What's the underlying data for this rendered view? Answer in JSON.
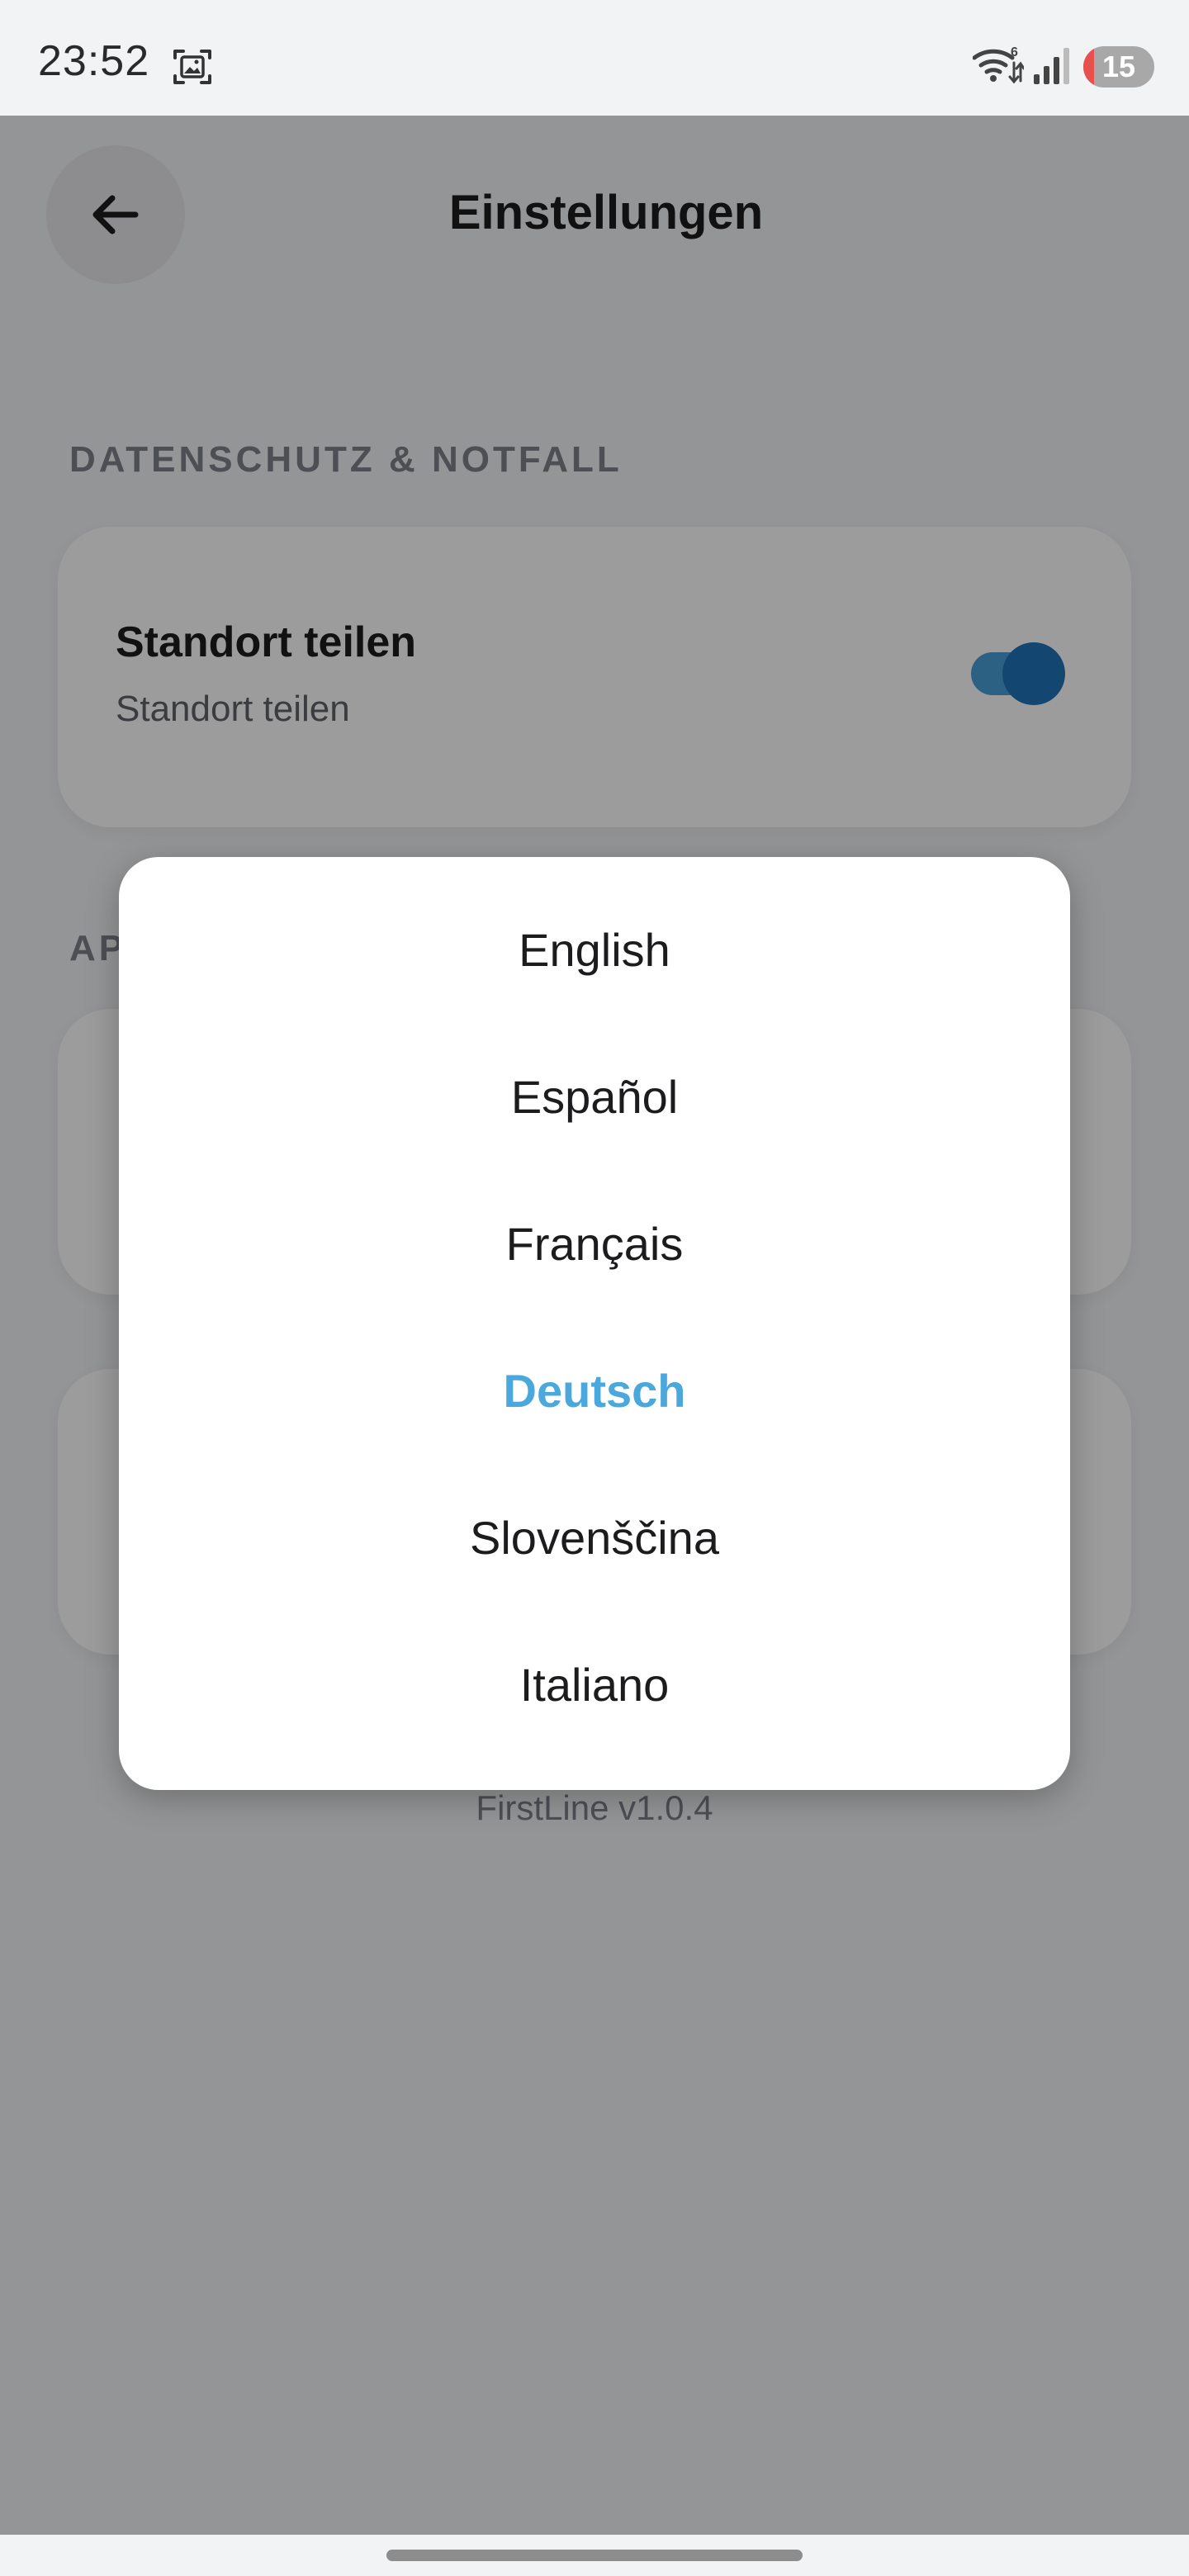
{
  "status_bar": {
    "time": "23:52",
    "wifi_badge": "6",
    "battery_level": "15",
    "battery_fraction": 0.15
  },
  "header": {
    "title": "Einstellungen",
    "back_icon": "arrow-left-icon"
  },
  "sections": {
    "privacy": {
      "header": "DATENSCHUTZ & NOTFALL",
      "location_card": {
        "title": "Standort teilen",
        "subtitle": "Standort teilen",
        "enabled": true
      }
    },
    "app": {
      "header_visible": "AP"
    }
  },
  "footer": {
    "version": "FirstLine v1.0.4"
  },
  "language_dialog": {
    "options": [
      {
        "label": "English"
      },
      {
        "label": "Español"
      },
      {
        "label": "Français"
      },
      {
        "label": "Deutsch"
      },
      {
        "label": "Slovenščina"
      },
      {
        "label": "Italiano"
      }
    ],
    "selected": "Deutsch"
  },
  "colors": {
    "accent": "#4ba8dc",
    "toggle_thumb": "#1f73b7",
    "toggle_track": "#4a9fd7",
    "battery_low": "#e8504e"
  }
}
